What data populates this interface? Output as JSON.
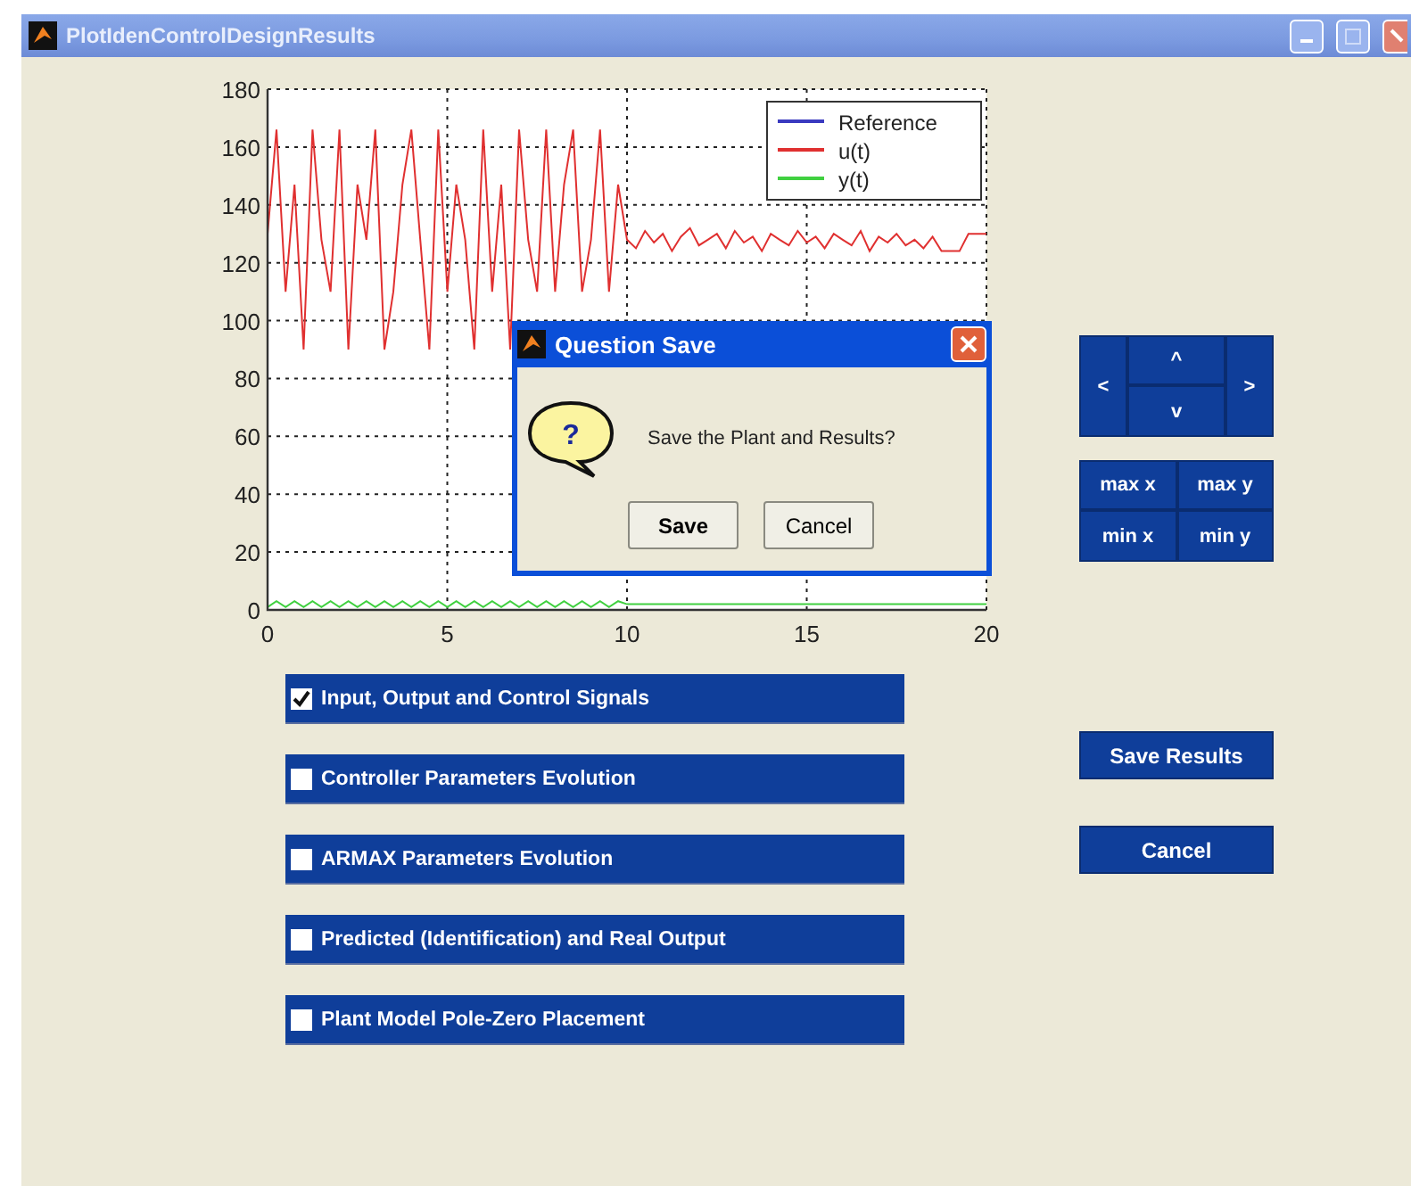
{
  "window": {
    "title": "PlotIdenControlDesignResults"
  },
  "plot": {
    "chart_data": {
      "type": "line",
      "grid": true,
      "legend": true,
      "xlim": [
        0,
        20
      ],
      "ylim": [
        0,
        180
      ],
      "xticks": [
        0,
        5,
        10,
        15,
        20
      ],
      "yticks": [
        0,
        20,
        40,
        60,
        80,
        100,
        120,
        140,
        160,
        180
      ],
      "x": [
        0,
        0.25,
        0.5,
        0.75,
        1,
        1.25,
        1.5,
        1.75,
        2,
        2.25,
        2.5,
        2.75,
        3,
        3.25,
        3.5,
        3.75,
        4,
        4.25,
        4.5,
        4.75,
        5,
        5.25,
        5.5,
        5.75,
        6,
        6.25,
        6.5,
        6.75,
        7,
        7.25,
        7.5,
        7.75,
        8,
        8.25,
        8.5,
        8.75,
        9,
        9.25,
        9.5,
        9.75,
        10,
        10.25,
        10.5,
        10.75,
        11,
        11.25,
        11.5,
        11.75,
        12,
        12.25,
        12.5,
        12.75,
        13,
        13.25,
        13.5,
        13.75,
        14,
        14.25,
        14.5,
        14.75,
        15,
        15.25,
        15.5,
        15.75,
        16,
        16.25,
        16.5,
        16.75,
        17,
        17.25,
        17.5,
        17.75,
        18,
        18.25,
        18.5,
        18.75,
        19,
        19.25,
        19.5,
        19.75,
        20
      ],
      "series": [
        {
          "name": "Reference",
          "color": "#3a3ac0",
          "values": [
            null,
            null,
            null,
            null,
            null,
            null,
            null,
            null,
            null,
            null,
            null,
            null,
            null,
            null,
            null,
            null,
            null,
            null,
            null,
            null,
            null,
            null,
            null,
            null,
            null,
            null,
            null,
            null,
            null,
            null,
            null,
            null,
            null,
            null,
            null,
            null,
            null,
            null,
            null,
            null,
            null,
            null,
            null,
            null,
            null,
            null,
            null,
            null,
            null,
            null,
            null,
            null,
            null,
            null,
            null,
            null,
            null,
            null,
            null,
            null,
            null,
            null,
            null,
            null,
            null,
            null,
            null,
            null,
            null,
            null,
            null,
            null,
            null,
            null,
            null,
            null,
            null,
            null,
            null,
            null,
            null
          ]
        },
        {
          "name": "u(t)",
          "color": "#e03030",
          "values": [
            130,
            166,
            110,
            147,
            90,
            166,
            128,
            110,
            166,
            90,
            147,
            128,
            166,
            90,
            110,
            147,
            166,
            128,
            90,
            166,
            110,
            147,
            128,
            90,
            166,
            110,
            147,
            90,
            166,
            128,
            110,
            166,
            110,
            147,
            166,
            110,
            128,
            166,
            110,
            147,
            128,
            125,
            131,
            127,
            130,
            124,
            129,
            132,
            126,
            128,
            130,
            125,
            131,
            127,
            129,
            124,
            130,
            128,
            126,
            131,
            127,
            129,
            125,
            130,
            128,
            126,
            131,
            124,
            129,
            127,
            130,
            126,
            128,
            125,
            129,
            124,
            124,
            124,
            130,
            130,
            130
          ]
        },
        {
          "name": "y(t)",
          "color": "#40d040",
          "values": [
            1,
            3,
            1,
            3,
            1,
            3,
            1,
            3,
            1,
            3,
            1,
            3,
            1,
            3,
            1,
            3,
            1,
            3,
            1,
            3,
            1,
            3,
            1,
            3,
            1,
            3,
            1,
            3,
            1,
            3,
            1,
            3,
            1,
            3,
            1,
            3,
            1,
            3,
            1,
            3,
            2,
            2,
            2,
            2,
            2,
            2,
            2,
            2,
            2,
            2,
            2,
            2,
            2,
            2,
            2,
            2,
            2,
            2,
            2,
            2,
            2,
            2,
            2,
            2,
            2,
            2,
            2,
            2,
            2,
            2,
            2,
            2,
            2,
            2,
            2,
            2,
            2,
            2,
            2,
            2,
            2
          ]
        }
      ]
    }
  },
  "signals": [
    {
      "name": "Input, Output and Control Signals",
      "checked": true
    },
    {
      "name": "Controller Parameters Evolution",
      "checked": false
    },
    {
      "name": "ARMAX Parameters Evolution",
      "checked": false
    },
    {
      "name": "Predicted (Identification) and Real Output",
      "checked": false
    },
    {
      "name": "Plant Model Pole-Zero Placement",
      "checked": false
    }
  ],
  "navigation": {
    "left": "<",
    "up": "^",
    "down": "v",
    "right": ">"
  },
  "limits": [
    "max x",
    "max y",
    "min x",
    "min y"
  ],
  "buttons": [
    "Save Results",
    "Cancel"
  ],
  "dialog": {
    "title": "Question Save",
    "icon_glyph": "?",
    "message": "Save the Plant and Results?",
    "buttons": [
      "Save",
      "Cancel"
    ]
  }
}
